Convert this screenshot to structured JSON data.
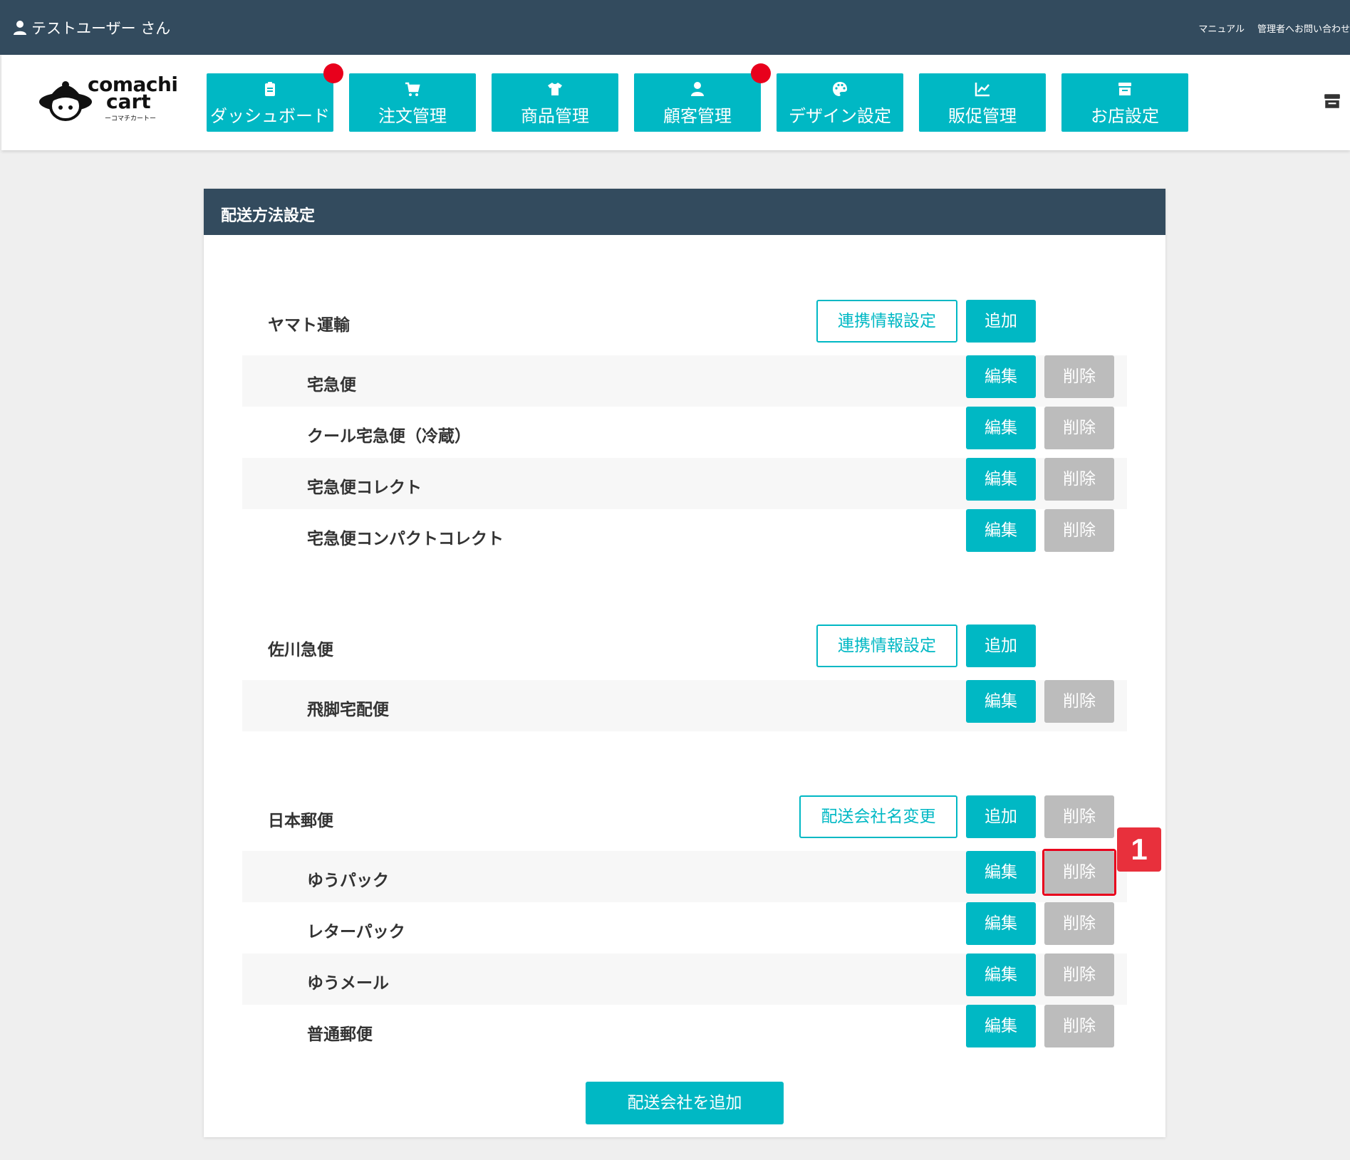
{
  "topbar": {
    "user": "テストユーザー さん",
    "links": [
      "マニュアル",
      "管理者へお問い合わせ"
    ]
  },
  "logo": {
    "line1": "comachi",
    "line2": "cart",
    "line3": "ーコマチカートー"
  },
  "nav": [
    {
      "label": "ダッシュボード",
      "icon": "clipboard-icon",
      "notify": true
    },
    {
      "label": "注文管理",
      "icon": "cart-icon",
      "notify": false
    },
    {
      "label": "商品管理",
      "icon": "shirt-icon",
      "notify": false
    },
    {
      "label": "顧客管理",
      "icon": "person-icon",
      "notify": true
    },
    {
      "label": "デザイン設定",
      "icon": "palette-icon",
      "notify": false
    },
    {
      "label": "販促管理",
      "icon": "chart-icon",
      "notify": false
    },
    {
      "label": "お店設定",
      "icon": "store-icon",
      "notify": false
    }
  ],
  "panel": {
    "title": "配送方法設定"
  },
  "buttons": {
    "link_settings": "連携情報設定",
    "rename_company": "配送会社名変更",
    "add": "追加",
    "edit": "編集",
    "delete": "削除",
    "add_company": "配送会社を追加"
  },
  "companies": [
    {
      "name": "ヤマト運輸",
      "methods": [
        "宅急便",
        "クール宅急便（冷蔵）",
        "宅急便コレクト",
        "宅急便コンパクトコレクト"
      ]
    },
    {
      "name": "佐川急便",
      "methods": [
        "飛脚宅配便"
      ]
    },
    {
      "name": "日本郵便",
      "methods": [
        "ゆうパック",
        "レターパック",
        "ゆうメール",
        "普通郵便"
      ]
    }
  ],
  "annotation": {
    "number": "1"
  },
  "colors": {
    "accent": "#00b8c4",
    "header": "#334b5e",
    "disabled": "#bcbcbc",
    "alert": "#e8001c"
  }
}
